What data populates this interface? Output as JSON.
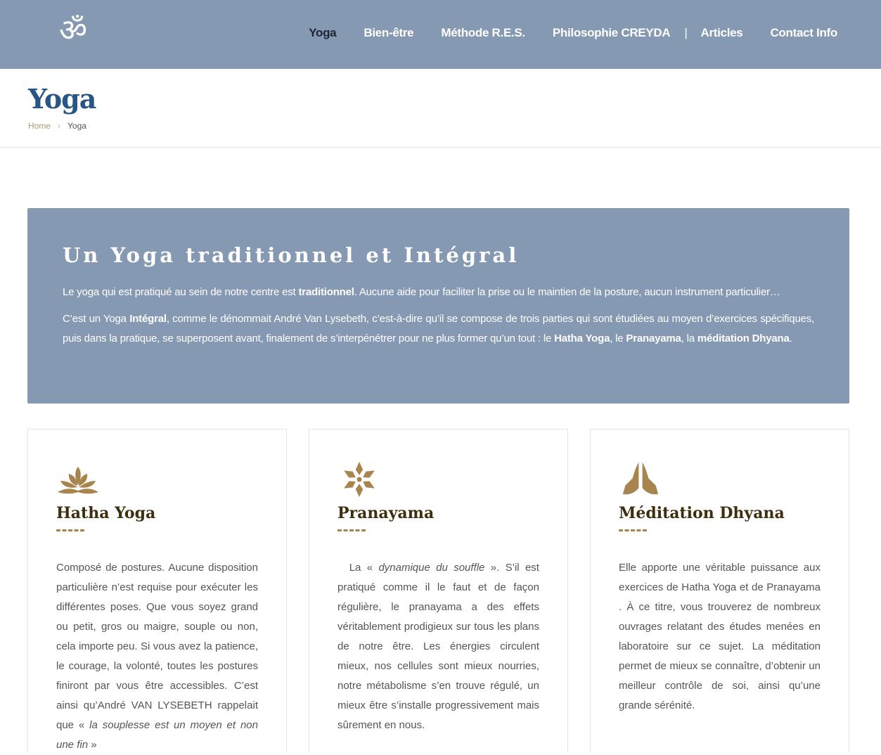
{
  "header": {
    "logo": "ॐ",
    "nav": [
      "Yoga",
      "Bien-être",
      "Méthode R.E.S.",
      "Philosophie CREYDA",
      "|",
      "Articles",
      "Contact Info"
    ]
  },
  "page": {
    "title": "Yoga",
    "breadcrumb": {
      "home": "Home",
      "sep": "›",
      "current": "Yoga"
    }
  },
  "banner": {
    "title": "Un Yoga traditionnel et Intégral",
    "p1": [
      "Le yoga qui est pratiqué au sein de notre centre est ",
      "traditionnel",
      ". Aucune aide pour faciliter la prise ou le maintien de la posture, aucun instrument particulier…"
    ],
    "p2": [
      "C’est un Yoga ",
      "Intégral",
      ", comme le dénommait André Van Lysebeth, c’est-à-dire qu’il se compose de trois parties qui sont étudiées au moyen d’exercices spécifiques, puis dans la pratique, se superposent avant, finalement de s’interpénétrer pour ne plus former qu’un tout : le ",
      "Hatha Yoga",
      ", le ",
      "Pranayama",
      ", la ",
      "méditation Dhyana",
      "."
    ]
  },
  "cards": [
    {
      "icon": "lotus-icon",
      "title": "Hatha Yoga",
      "text": "Composé de postures. Aucune disposition particulière n’est requise pour exécuter les différentes poses. Que vous soyez grand ou petit, gros ou maigre, souple ou non, cela importe peu. Si vous avez la patience, le courage, la volonté, toutes les postures finiront par vous être accessibles. C’est ainsi qu’André VAN LYSEBETH rappelait que « ",
      "italic": "la souplesse est un moyen et non une fin",
      "tail": " »"
    },
    {
      "icon": "flower-icon",
      "title": "Pranayama",
      "text": "La « ",
      "italic": "dynamique du souffle",
      "tail": " ». S’il est pratiqué comme il le faut et de façon régulière, le pranayama a des effets véritablement prodigieux sur tous les plans de notre être. Les énergies circulent mieux, nos cellules sont mieux nourries, notre métabolisme s’en trouve régulé, un mieux être s’installe progressivement mais sûrement en nous."
    },
    {
      "icon": "praying-hands-icon",
      "title": "Méditation Dhyana",
      "text": "Elle apporte une véritable puissance aux exercices de Hatha Yoga et de Pranayama . À ce titre, vous trouverez de nombreux ouvrages relatant des études menées en laboratoire sur ce sujet. La méditation permet de mieux se connaître, d’obtenir un meilleur contrôle de soi, ainsi qu’une grande sérénité."
    }
  ],
  "colors": {
    "header": "#8599b2",
    "title": "#275685",
    "gold": "#a8844f"
  }
}
